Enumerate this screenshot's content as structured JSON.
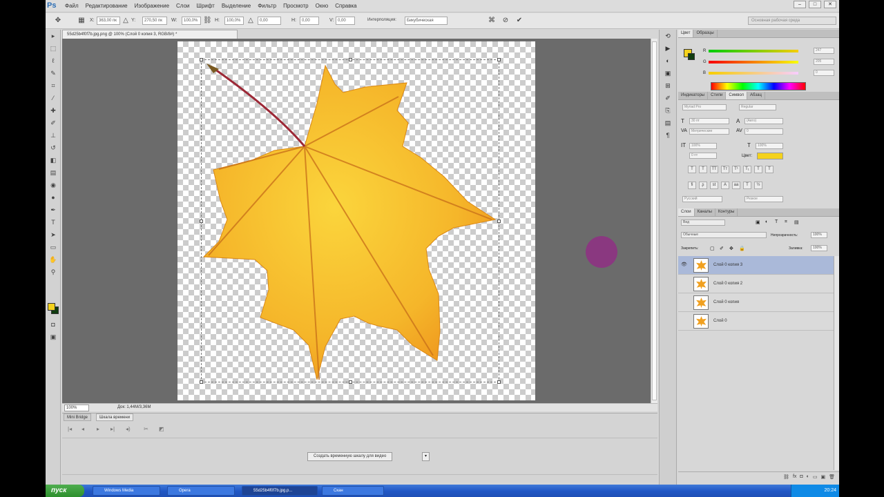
{
  "app": {
    "logo": "Ps"
  },
  "menu": [
    "Файл",
    "Редактирование",
    "Изображение",
    "Слои",
    "Шрифт",
    "Выделение",
    "Фильтр",
    "Просмотр",
    "Окно",
    "Справка"
  ],
  "options": {
    "x": "363,00 пк",
    "y": "270,50 пк",
    "w": "100,0%",
    "h": "100,0%",
    "angle": "0,00",
    "hskew": "0,00",
    "vskew": "0,00",
    "interp_label": "Интерполяция:",
    "interp_value": "Бикубическая",
    "workspace": "Основная рабочая среда"
  },
  "document": {
    "tab_title": "55d25b4f0f7b.jpg.png @ 100% (Слой 0 копия 3, RGB/8#) *",
    "zoom": "100%",
    "doc_info": "Док: 1,44M/3,36M"
  },
  "timeline": {
    "tabs": [
      "Mini Bridge",
      "Шкала времени"
    ],
    "create_button": "Создать временную шкалу для видео"
  },
  "color_panel": {
    "tabs": [
      "Цвет",
      "Образцы"
    ],
    "r": "247",
    "g": "205",
    "b": "0"
  },
  "char_panel": {
    "tabs": [
      "Индикаторы",
      "Стили",
      "Символ",
      "Абзац"
    ],
    "font_family": "Myriad Pro",
    "font_style": "Regular",
    "size": "30 пт",
    "leading": "(Авто)",
    "kerning": "Метрические",
    "tracking": "0",
    "vscale": "100%",
    "hscale": "100%",
    "baseline": "0 пт",
    "color_label": "Цвет:",
    "lang": "Русский",
    "aa": "Резкое"
  },
  "layers_panel": {
    "tabs": [
      "Слои",
      "Каналы",
      "Контуры"
    ],
    "filter": "Вид",
    "blend_mode": "Обычные",
    "opacity_label": "Непрозрачность:",
    "opacity": "100%",
    "lock_label": "Закрепить:",
    "fill_label": "Заливка:",
    "fill": "100%",
    "layers": [
      {
        "name": "Слой 0 копия 3",
        "selected": true,
        "visible": true
      },
      {
        "name": "Слой 0 копия 2",
        "selected": false,
        "visible": false
      },
      {
        "name": "Слой 0 копия",
        "selected": false,
        "visible": false
      },
      {
        "name": "Слой 0",
        "selected": false,
        "visible": false
      }
    ]
  },
  "taskbar": {
    "start": "пуск",
    "tasks": [
      "Windows Media",
      "Opera",
      "55d25b4f0f7b.jpg.p...",
      "Скан"
    ],
    "clock": "20:24"
  },
  "colors": {
    "foreground": "#f4d21c",
    "background": "#103c10",
    "leaf": "#f4b22a",
    "cursor": "#8a3880",
    "selected_layer": "#aab9d9"
  }
}
